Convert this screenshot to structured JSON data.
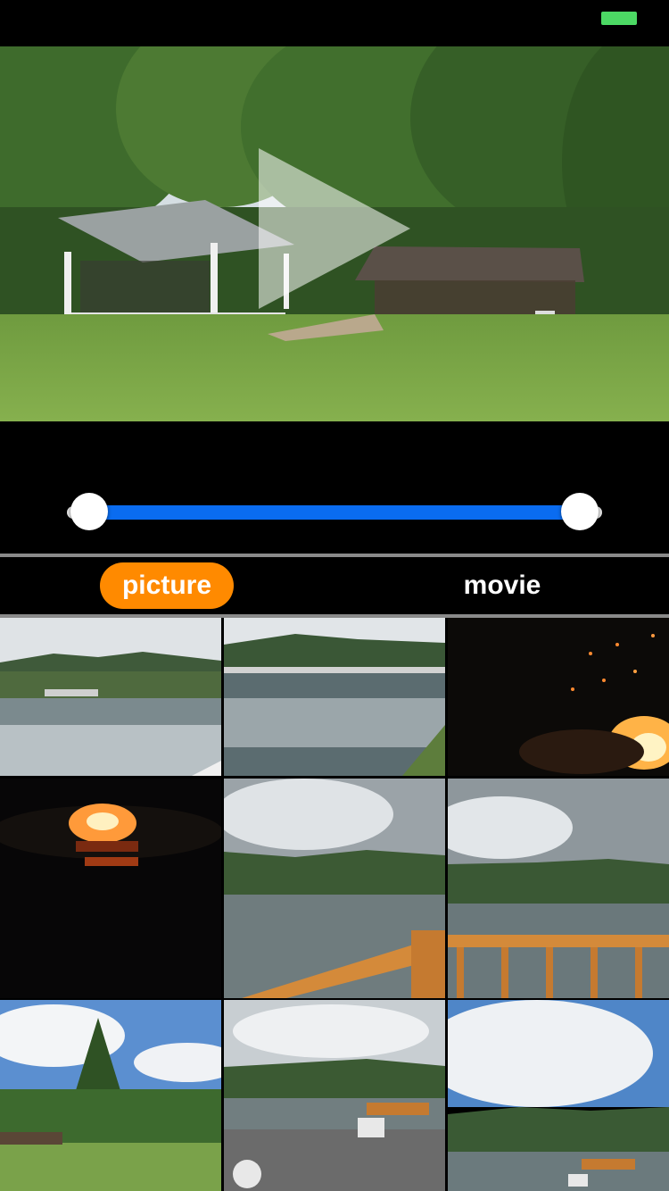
{
  "status_bar": {
    "battery_color": "#4cd964"
  },
  "video": {
    "play_icon": "play-icon"
  },
  "trimmer": {
    "start_fraction": 0.0,
    "end_fraction": 1.0,
    "track_color": "#0a6cf0"
  },
  "tabs": [
    {
      "label": "picture",
      "selected": true,
      "color": "#ff8a00"
    },
    {
      "label": "movie",
      "selected": false
    }
  ],
  "grid": {
    "columns": 3,
    "thumbnails": [
      "lake-reflection",
      "lake-reflection",
      "campfire-sparks",
      "campfire-night",
      "lake-deck-cloudy",
      "lake-deck-cloudy",
      "forest-meadow",
      "lake-parking",
      "lake-dock"
    ]
  }
}
